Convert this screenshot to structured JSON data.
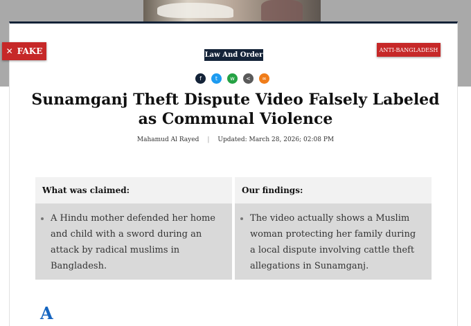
{
  "badge": {
    "label": "FAKE",
    "icon": "close-icon"
  },
  "category": "Law And Order",
  "topic_tag": "ANTI-BANGLADESH",
  "share": [
    {
      "icon": "facebook-icon",
      "glyph": "f"
    },
    {
      "icon": "twitter-icon",
      "glyph": "t"
    },
    {
      "icon": "whatsapp-icon",
      "glyph": "w"
    },
    {
      "icon": "share-icon",
      "glyph": "<"
    },
    {
      "icon": "link-icon",
      "glyph": "∞"
    }
  ],
  "headline": "Sunamganj Theft Dispute Video Falsely Labeled as Communal Violence",
  "author": "Mahamud Al Rayed",
  "updated": "Updated: March 28, 2026; 02:08 PM",
  "claims": {
    "claimed_title": "What was claimed:",
    "claimed_text": "A Hindu mother defended her home and child with a sword during an attack by radical muslims in Bangladesh.",
    "findings_title": "Our findings:",
    "findings_text": "The video actually shows a Muslim woman protecting her family during a local dispute involving cattle theft allegations in Sunamganj."
  },
  "body_start": "A",
  "colors": {
    "navy": "#142338",
    "red": "#c62828",
    "accent": "#1565c0"
  }
}
